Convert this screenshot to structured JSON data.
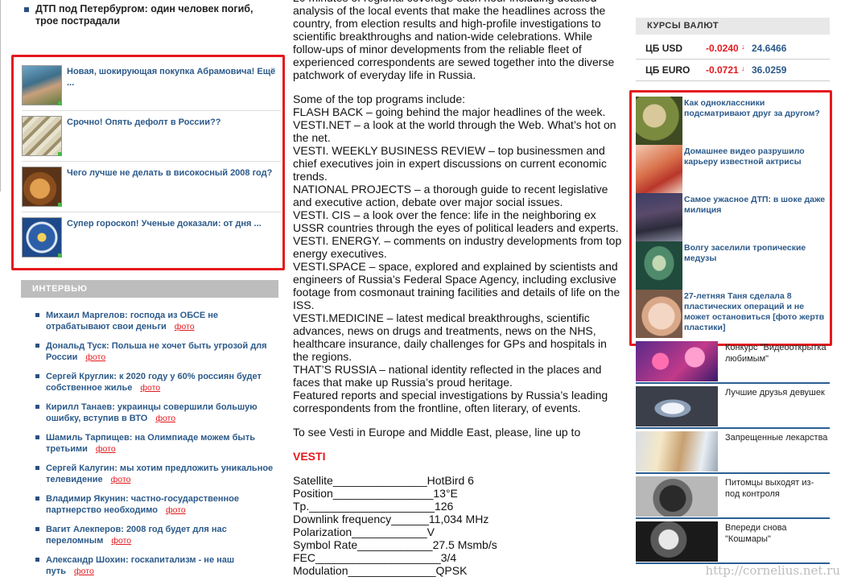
{
  "left": {
    "top_news": "ДТП под Петербургом: один человек погиб, трое пострадали",
    "teasers": [
      {
        "title": "Новая, шокирующая покупка Абрамовича! Ещё ...",
        "icon": "portrait-photo"
      },
      {
        "title": "Срочно! Опять дефолт в России??",
        "icon": "banknotes-photo"
      },
      {
        "title": "Чего лучше не делать в високосный 2008 год?",
        "icon": "pot-photo"
      },
      {
        "title": "Супер гороскоп! Ученые доказали: от дня ...",
        "icon": "zodiac-wheel-photo"
      }
    ],
    "interview_header": "ИНТЕРВЬЮ",
    "foto_label": "фото",
    "interviews": [
      {
        "text": "Михаил Маргелов: господа из ОБСЕ не отрабатывают свои деньги"
      },
      {
        "text": "Дональд Туск: Польша не хочет быть угрозой для России"
      },
      {
        "text": "Сергей Круглик: к 2020 году у 60% россиян будет собственное жилье"
      },
      {
        "text": "Кирилл Танаев: украинцы совершили большую ошибку, вступив в ВТО"
      },
      {
        "text": "Шамиль Тарпищев: на Олимпиаде можем быть третьими"
      },
      {
        "text": "Сергей Калугин: мы хотим предложить уникальное телевидение"
      },
      {
        "text": "Владимир Якунин: частно-государственное партнерство необходимо"
      },
      {
        "text": "Вагит Алекперов: 2008 год будет для нас переломным"
      },
      {
        "text": "Александр Шохин: госкапитализм - не наш путь"
      }
    ]
  },
  "middle": {
    "intro": "20 minutes of regional coverage each hour including detailed analysis of the local events that make the headlines across the country, from election results and high-profile investigations to scientific breakthroughs and nation-wide celebrations. While follow-ups of minor developments from the reliable fleet of experienced correspondents are sewed together into the diverse patchwork of everyday life in Russia.",
    "programs": [
      "Some of the top programs include:",
      "FLASH BACK – going behind the major headlines of the week.",
      "VESTI.NET – a look at the world through the Web. What’s hot on the net.",
      "VESTI. WEEKLY BUSINESS REVIEW – top businessmen and chief executives join in expert discussions on current economic trends.",
      "NATIONAL PROJECTS – a thorough guide to recent legislative and executive action, debate over major social issues.",
      "VESTI. CIS – a look over the fence: life in the neighboring ex USSR countries through the eyes of political leaders and experts.",
      "VESTI. ENERGY. – comments on industry developments from top energy executives.",
      "VESTI.SPACE – space, explored and explained by scientists and engineers of Russia’s Federal  Space Agency, including exclusive footage from cosmonaut training facilities and details of life on the ISS.",
      "VESTI.MEDICINE – latest medical breakthroughs, scientific advances, news on drugs and treatments, news on the NHS, healthcare insurance, daily challenges for GPs and hospitals in the regions.",
      "THAT’S RUSSIA – national identity reflected in the places and faces that make up Russia’s proud heritage.",
      "Featured reports and special investigations by Russia’s leading correspondents from the frontline, often literary, of events."
    ],
    "cta": "To see Vesti in Europe and Middle East, please, line up to",
    "vesti_label": "VESTI",
    "specs": [
      {
        "k": "Satellite_______________",
        "v": "HotBird 6"
      },
      {
        "k": "Position________________",
        "v": "13°E"
      },
      {
        "k": "Tp.____________________",
        "v": "126"
      },
      {
        "k": "Downlink frequency______",
        "v": "11,034 MHz"
      },
      {
        "k": "Polarization____________",
        "v": "V"
      },
      {
        "k": "Symbol Rate____________",
        "v": "27.5 Msmb/s"
      },
      {
        "k": "FEC____________________",
        "v": "3/4"
      },
      {
        "k": "Modulation______________",
        "v": "QPSK"
      }
    ]
  },
  "right": {
    "rates_header": "КУРСЫ ВАЛЮТ",
    "rates": [
      {
        "name": "ЦБ USD",
        "delta": "-0.0240",
        "arrow": "↓",
        "value": "24.6466"
      },
      {
        "name": "ЦБ EURO",
        "delta": "-0.0721",
        "arrow": "↓",
        "value": "36.0259"
      }
    ],
    "teasers": [
      {
        "title": "Как одноклассники подсматривают друг за другом?",
        "icon": "finger-photo"
      },
      {
        "title": "Домашнее видео разрушило карьеру известной актрисы",
        "icon": "actress-photo"
      },
      {
        "title": "Самое ужасное ДТП: в шоке даже милиция",
        "icon": "crash-photo"
      },
      {
        "title": "Волгу заселили тропические медузы",
        "icon": "jellyfish-photo"
      },
      {
        "title": "27-летняя Таня сделала 8 пластических операций и не может остановиться [фото жертв пластики]",
        "icon": "girl-face-photo"
      }
    ],
    "list": [
      {
        "title": "Конкурс \"Видеооткрытка любимым\"",
        "icon": "hearts-picture"
      },
      {
        "title": "Лучшие друзья девушек",
        "icon": "diamonds-photo"
      },
      {
        "title": "Запрещенные лекарства",
        "icon": "pills-photo"
      },
      {
        "title": "Питомцы выходят из-под контроля",
        "icon": "dog-photo"
      },
      {
        "title": "Впереди снова \"Кошмары\"",
        "icon": "horror-photo"
      }
    ]
  },
  "watermark": "http://cornelius.net.ru",
  "colors": {
    "accent_red": "#e4191e",
    "link_blue": "#2c5a8a",
    "header_gray": "#bdbdbd"
  }
}
